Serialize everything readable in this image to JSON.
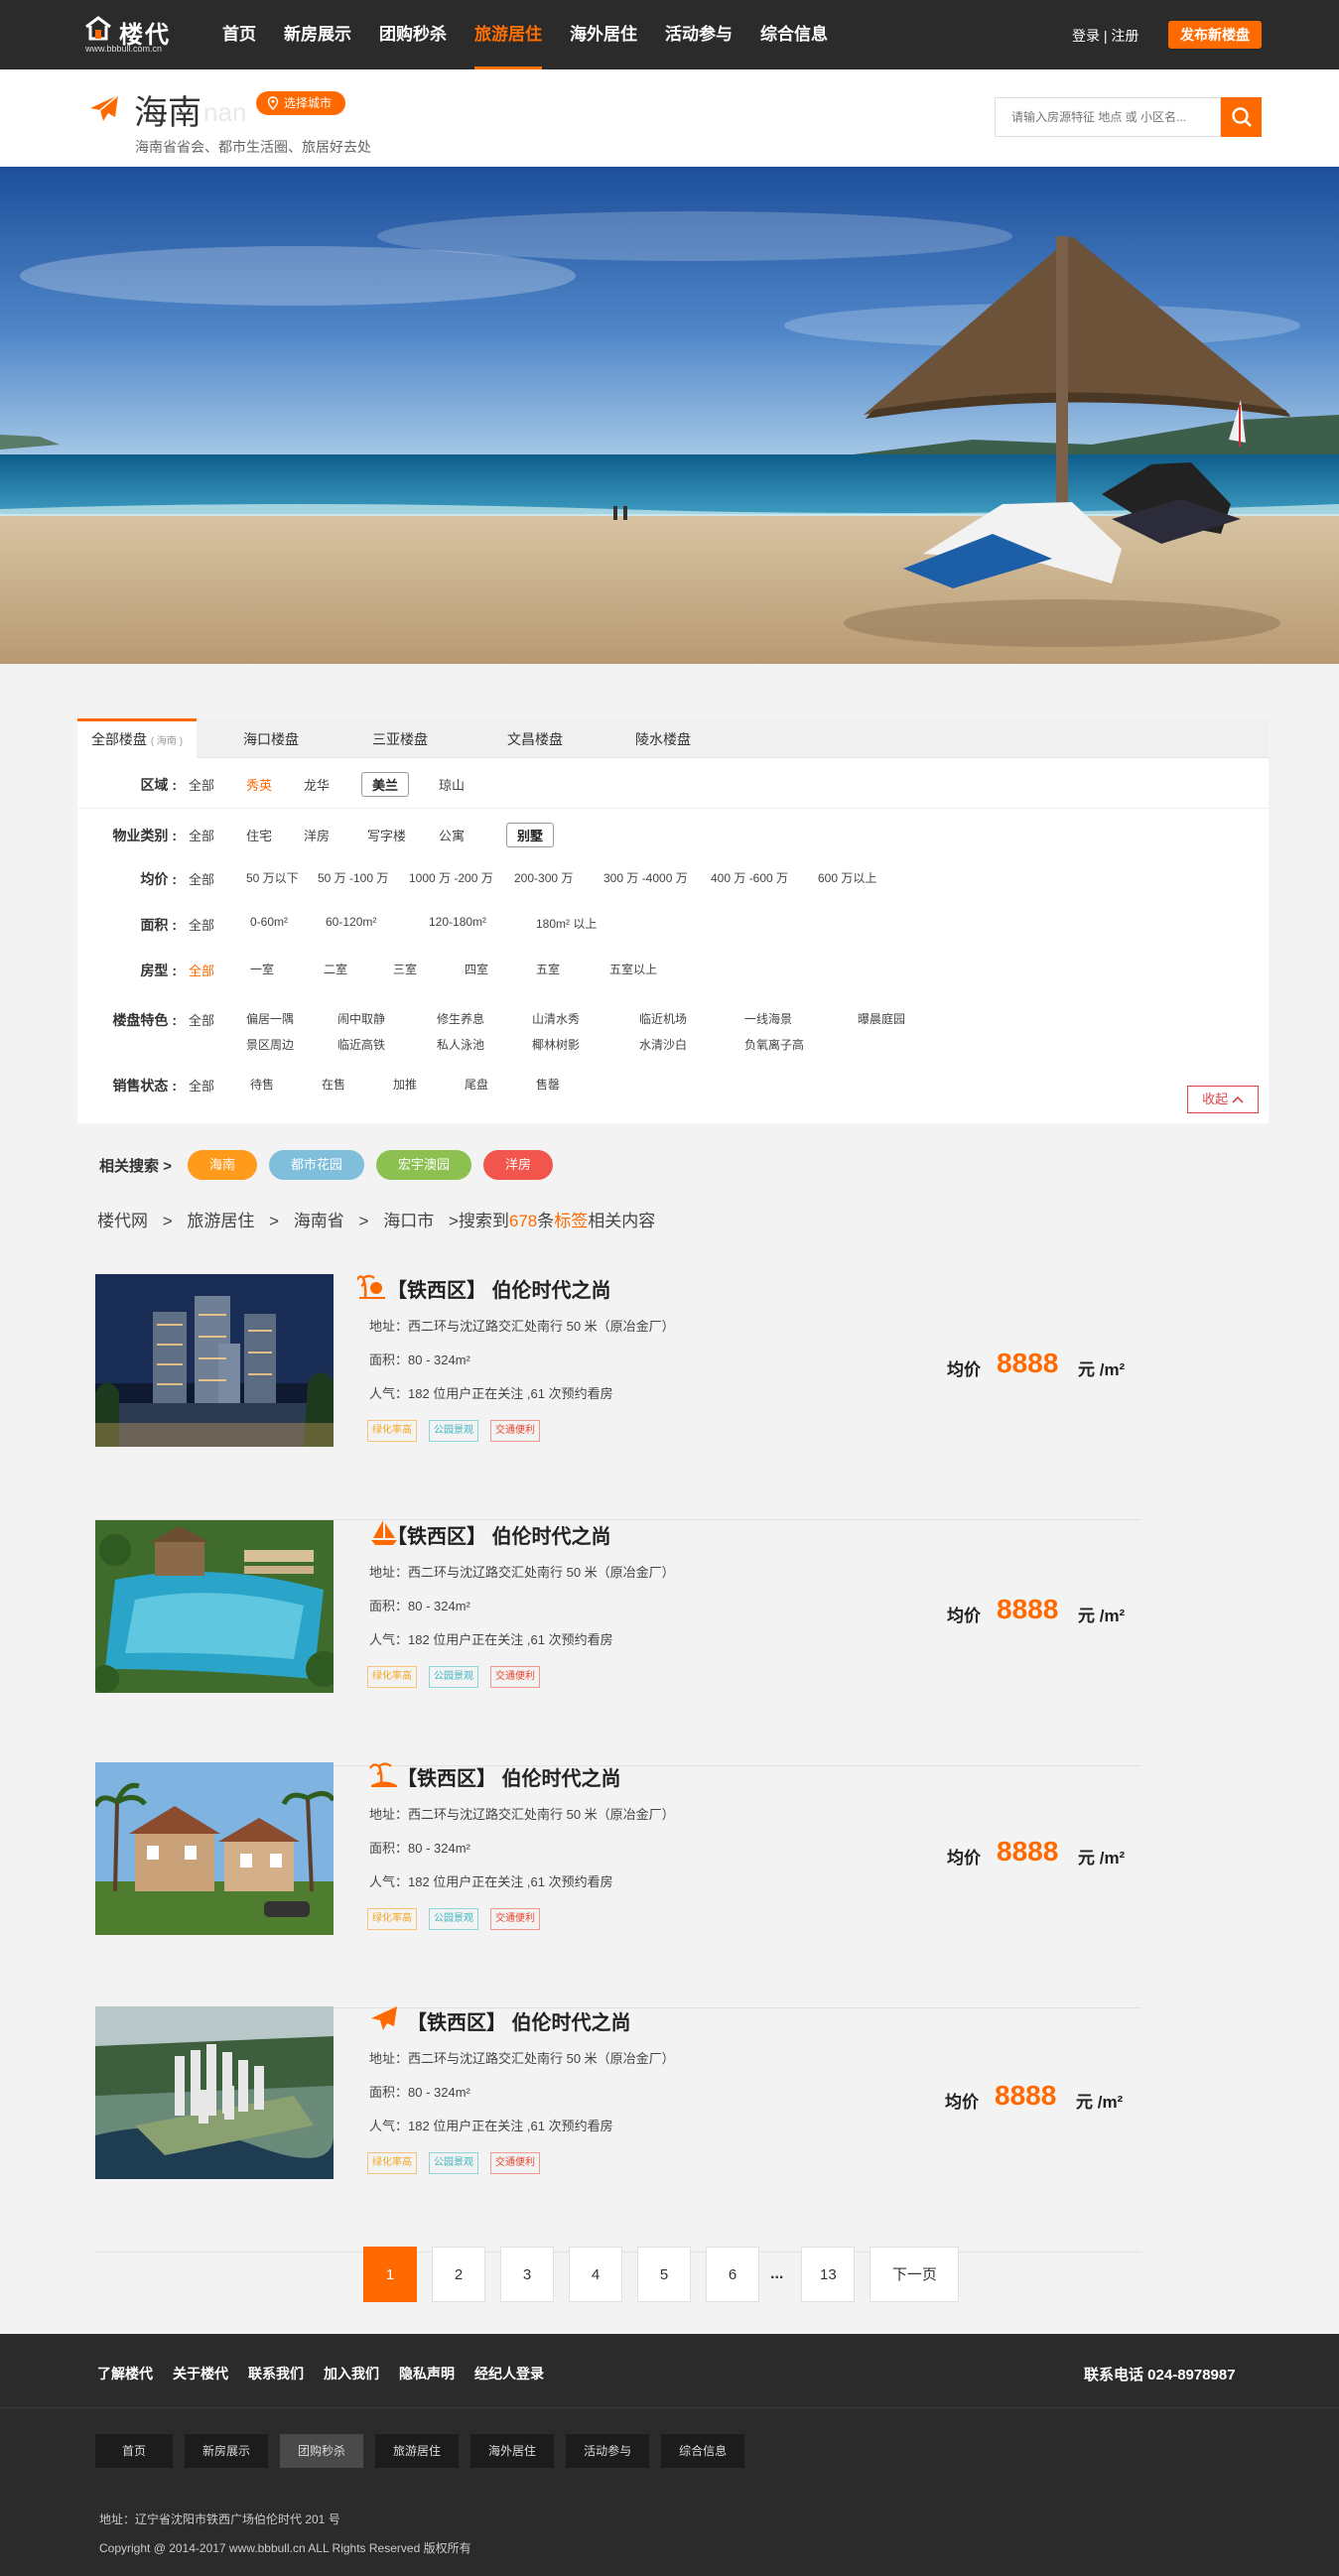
{
  "header": {
    "logo_text": "楼代",
    "logo_url": "www.bbbull.com.cn",
    "nav": [
      {
        "label": "首页",
        "active": false
      },
      {
        "label": "新房展示",
        "active": false
      },
      {
        "label": "团购秒杀",
        "active": false
      },
      {
        "label": "旅游居住",
        "active": true
      },
      {
        "label": "海外居住",
        "active": false
      },
      {
        "label": "活动参与",
        "active": false
      },
      {
        "label": "综合信息",
        "active": false
      }
    ],
    "login": "登录",
    "sep": "|",
    "register": "注册",
    "publish": "发布新楼盘"
  },
  "city": {
    "name": "海南",
    "ghost": "nan",
    "choose": "选择城市",
    "subtitle": "海南省省会、都市生活圈、旅居好去处",
    "search_placeholder": "请输入房源特征 地点 或 小区名..."
  },
  "filter": {
    "tabs": [
      {
        "label": "全部楼盘",
        "sub": "( 海南 )",
        "active": true
      },
      {
        "label": "海口楼盘",
        "active": false
      },
      {
        "label": "三亚楼盘",
        "active": false
      },
      {
        "label": "文昌楼盘",
        "active": false
      },
      {
        "label": "陵水楼盘",
        "active": false
      }
    ],
    "region": {
      "label": "区域 :",
      "options": [
        "全部",
        "秀英",
        "龙华",
        "美兰",
        "琼山"
      ]
    },
    "type": {
      "label": "物业类别 :",
      "options": [
        "全部",
        "住宅",
        "洋房",
        "写字楼",
        "公寓",
        "别墅"
      ]
    },
    "price": {
      "label": "均价 :",
      "options": [
        "全部",
        "50 万以下",
        "50 万 -100 万",
        "1000 万 -200 万",
        "200-300 万",
        "300 万 -4000 万",
        "400 万 -600 万",
        "600 万以上"
      ]
    },
    "area": {
      "label": "面积 :",
      "options": [
        "全部",
        "0-60m²",
        "60-120m²",
        "120-180m²",
        "180m² 以上"
      ]
    },
    "layout": {
      "label": "房型 :",
      "options": [
        "全部",
        "一室",
        "二室",
        "三室",
        "四室",
        "五室",
        "五室以上"
      ]
    },
    "feature": {
      "label": "楼盘特色 :",
      "all": "全部",
      "row1": [
        "偏居一隅",
        "闹中取静",
        "修生养息",
        "山清水秀",
        "临近机场",
        "一线海景",
        "曝晨庭园"
      ],
      "row2": [
        "景区周边",
        "临近高铁",
        "私人泳池",
        "椰林树影",
        "水清沙白",
        "负氧离子高"
      ]
    },
    "status": {
      "label": "销售状态 :",
      "options": [
        "全部",
        "待售",
        "在售",
        "加推",
        "尾盘",
        "售罄"
      ]
    },
    "collapse": "收起"
  },
  "related": {
    "label": "相关搜索",
    "arrow": ">",
    "tags": [
      {
        "label": "海南",
        "color": "#ff9a1a"
      },
      {
        "label": "都市花园",
        "color": "#7fbfdc"
      },
      {
        "label": "宏宇澳园",
        "color": "#8cc152"
      },
      {
        "label": "洋房",
        "color": "#f2554b"
      }
    ]
  },
  "breadcrumb": {
    "items": [
      "楼代网",
      ">",
      "旅游居住",
      ">",
      "海南省",
      ">",
      "海口市"
    ],
    "result_pre": ">搜索到",
    "count": "678",
    "result_mid": "条",
    "keyword": "标签",
    "result_post": "相关内容"
  },
  "listings": [
    {
      "icon": "palm-sunset-icon",
      "title": "【铁西区】 伯伦时代之尚",
      "address": "地址：西二环与沈辽路交汇处南行 50 米（原冶金厂）",
      "area": "面积：80 - 324m²",
      "popularity": "人气：182 位用户正在关注 ,61 次预约看房",
      "tags": [
        "绿化率高",
        "公园景观",
        "交通便利"
      ],
      "price_label": "均价",
      "price": "8888",
      "unit": "元 /m²"
    },
    {
      "icon": "sailboat-icon",
      "title": "【铁西区】 伯伦时代之尚",
      "address": "地址：西二环与沈辽路交汇处南行 50 米（原冶金厂）",
      "area": "面积：80 - 324m²",
      "popularity": "人气：182 位用户正在关注 ,61 次预约看房",
      "tags": [
        "绿化率高",
        "公园景观",
        "交通便利"
      ],
      "price_label": "均价",
      "price": "8888",
      "unit": "元 /m²"
    },
    {
      "icon": "island-icon",
      "title": "【铁西区】 伯伦时代之尚",
      "address": "地址：西二环与沈辽路交汇处南行 50 米（原冶金厂）",
      "area": "面积：80 - 324m²",
      "popularity": "人气：182 位用户正在关注 ,61 次预约看房",
      "tags": [
        "绿化率高",
        "公园景观",
        "交通便利"
      ],
      "price_label": "均价",
      "price": "8888",
      "unit": "元 /m²"
    },
    {
      "icon": "plane-icon",
      "title": "【铁西区】 伯伦时代之尚",
      "address": "地址：西二环与沈辽路交汇处南行 50 米（原冶金厂）",
      "area": "面积：80 - 324m²",
      "popularity": "人气：182 位用户正在关注 ,61 次预约看房",
      "tags": [
        "绿化率高",
        "公园景观",
        "交通便利"
      ],
      "price_label": "均价",
      "price": "8888",
      "unit": "元 /m²"
    }
  ],
  "pagination": {
    "pages": [
      "1",
      "2",
      "3",
      "4",
      "5",
      "6"
    ],
    "dots": "...",
    "last": "13",
    "next": "下一页",
    "current": "1"
  },
  "footer": {
    "links": [
      "了解楼代",
      "关于楼代",
      "联系我们",
      "加入我们",
      "隐私声明",
      "经纪人登录"
    ],
    "phone": "联系电话  024-8978987",
    "nav": [
      "首页",
      "新房展示",
      "团购秒杀",
      "旅游居住",
      "海外居住",
      "活动参与",
      "综合信息"
    ],
    "address": "地址：辽宁省沈阳市铁西广场伯伦时代 201 号",
    "copyright": "Copyright @ 2014-2017  www.bbbull.cn  ALL Rights  Reserved  版权所有"
  },
  "colors": {
    "accent": "#ff6a00",
    "header_bg": "#2b2b2b"
  }
}
